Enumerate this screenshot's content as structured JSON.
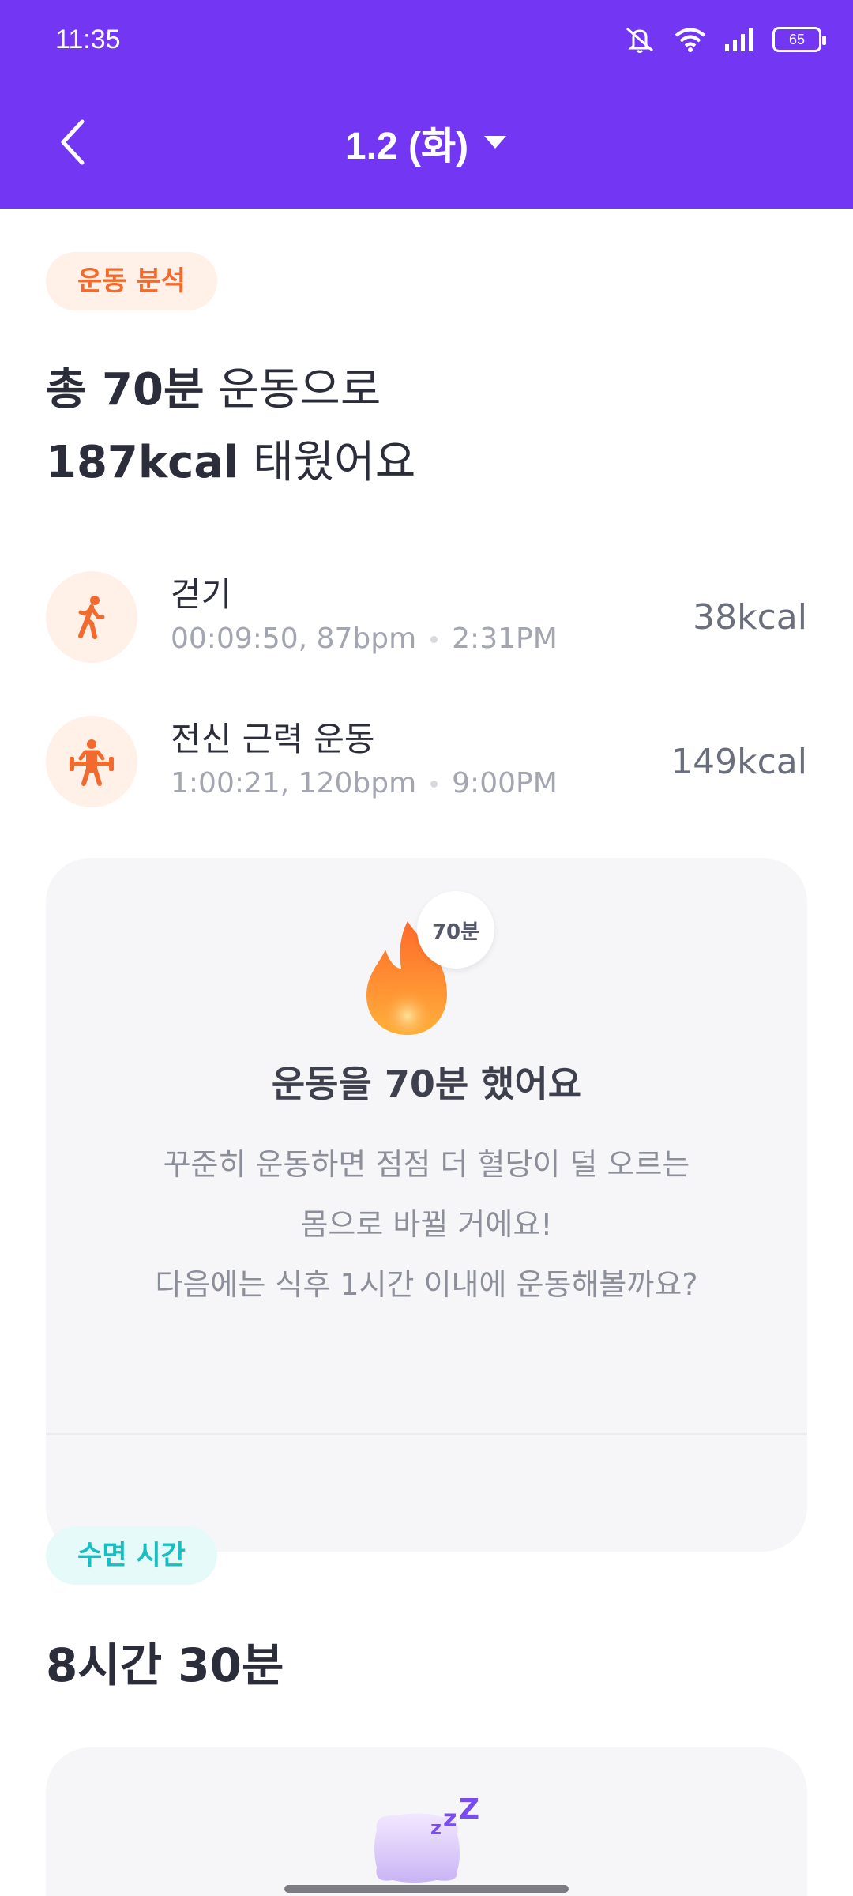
{
  "status_bar": {
    "time": "11:35",
    "battery": "65"
  },
  "header": {
    "title": "1.2 (화)"
  },
  "exercise": {
    "tag": "운동 분석",
    "headline_total_bold": "총 70분",
    "headline_total_rest": " 운동으로",
    "headline_kcal_bold": "187kcal",
    "headline_kcal_rest": " 태웠어요",
    "activities": [
      {
        "name": "걷기",
        "stats": "00:09:50, 87bpm",
        "time": "2:31PM",
        "kcal": "38kcal",
        "icon": "walking-icon"
      },
      {
        "name": "전신 근력 운동",
        "stats": "1:00:21, 120bpm",
        "time": "9:00PM",
        "kcal": "149kcal",
        "icon": "weightlifting-icon"
      }
    ],
    "summary": {
      "badge": "70분",
      "title": "운동을 70분 했어요",
      "lines": [
        "꾸준히 운동하면 점점 더 혈당이 덜 오르는",
        "몸으로 바뀔 거에요!",
        "다음에는 식후 1시간 이내에 운동해볼까요?"
      ]
    }
  },
  "sleep": {
    "tag": "수면 시간",
    "headline": "8시간 30분"
  },
  "colors": {
    "brand": "#7336f2",
    "orange": "#f26a2d",
    "teal": "#18bfc0"
  }
}
